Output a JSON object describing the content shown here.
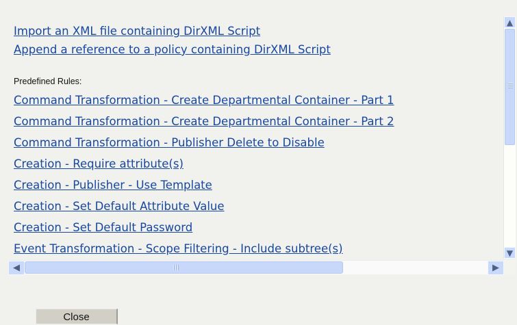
{
  "top_links": [
    "Import an XML file containing DirXML Script",
    "Append a reference to a policy containing DirXML Script"
  ],
  "section_label": "Predefined Rules:",
  "rules": [
    "Command Transformation - Create Departmental Container - Part 1",
    "Command Transformation - Create Departmental Container - Part 2",
    "Command Transformation - Publisher Delete to Disable",
    "Creation - Require attribute(s)",
    "Creation - Publisher - Use Template",
    "Creation - Set Default Attribute Value",
    "Creation - Set Default Password",
    "Event Transformation - Scope Filtering - Include subtree(s)"
  ],
  "scrollbar_icons": {
    "up": "up-arrow-icon",
    "down": "down-arrow-icon",
    "left": "left-arrow-icon",
    "right": "right-arrow-icon",
    "grip": "grip-icon"
  },
  "buttons": {
    "close_label": "Close"
  }
}
